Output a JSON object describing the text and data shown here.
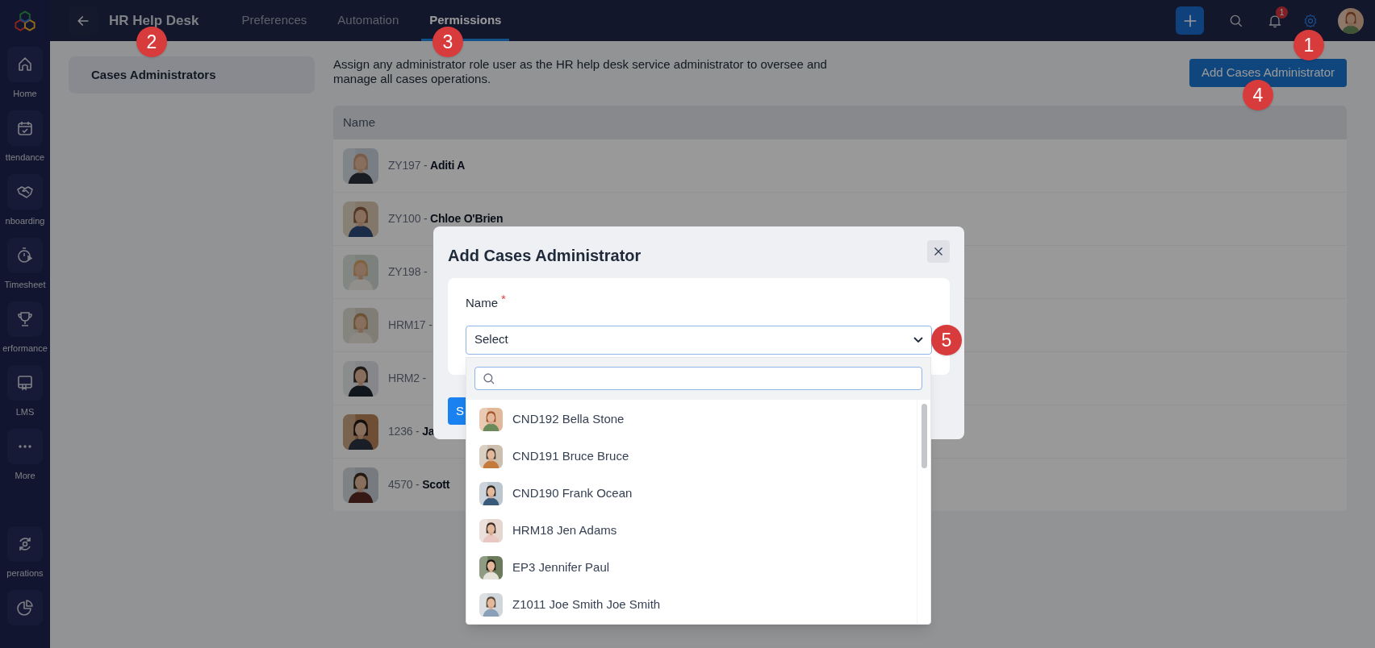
{
  "sidebar": {
    "items": [
      {
        "kind": "home",
        "label": "Home"
      },
      {
        "kind": "calendar",
        "label": "ttendance"
      },
      {
        "kind": "handshake",
        "label": "nboarding"
      },
      {
        "kind": "timer",
        "label": "Timesheet"
      },
      {
        "kind": "trophy",
        "label": "erformance"
      },
      {
        "kind": "board",
        "label": "LMS"
      },
      {
        "kind": "more",
        "label": "More"
      },
      {
        "kind": "cycle",
        "label": "perations"
      },
      {
        "kind": "pie"
      }
    ]
  },
  "top_bar": {
    "title": "HR Help Desk",
    "tabs": [
      {
        "label": "Preferences",
        "selected": false
      },
      {
        "label": "Automation",
        "selected": false
      },
      {
        "label": "Permissions",
        "selected": true
      }
    ],
    "notification_count": "1"
  },
  "left_panel": {
    "items": [
      {
        "label": "Cases Administrators",
        "selected": true
      }
    ]
  },
  "description": "Assign any administrator role user as the HR help desk service administrator to oversee and manage all cases operations.",
  "add_button": "Add Cases Administrator",
  "table": {
    "columns": [
      "Name"
    ],
    "rows": [
      {
        "text": "ZY197 - **Aditi A**"
      },
      {
        "text": "ZY100 - **Chloe O'Brien**"
      },
      {
        "text": "ZY198 -"
      },
      {
        "text": "HRM17 -"
      },
      {
        "text": "HRM2 -"
      },
      {
        "text": "1236 - **Ja**"
      },
      {
        "text": "4570 - **Scott**"
      }
    ]
  },
  "modal": {
    "title": "Add Cases Administrator",
    "field": {
      "label": "Name",
      "required_mark": "*",
      "selected_text": "Select"
    },
    "submit_button": "S",
    "dropdown": {
      "options": [
        {
          "label": "CND192 Bella Stone"
        },
        {
          "label": "CND191 Bruce Bruce"
        },
        {
          "label": "CND190 Frank Ocean"
        },
        {
          "label": "HRM18 Jen Adams"
        },
        {
          "label": "EP3 Jennifer Paul"
        },
        {
          "label": "Z1011 Joe Smith Joe Smith"
        }
      ]
    }
  },
  "callouts": [
    {
      "label": "2"
    },
    {
      "label": "3"
    },
    {
      "label": "1"
    },
    {
      "label": "4"
    },
    {
      "label": "5"
    }
  ]
}
